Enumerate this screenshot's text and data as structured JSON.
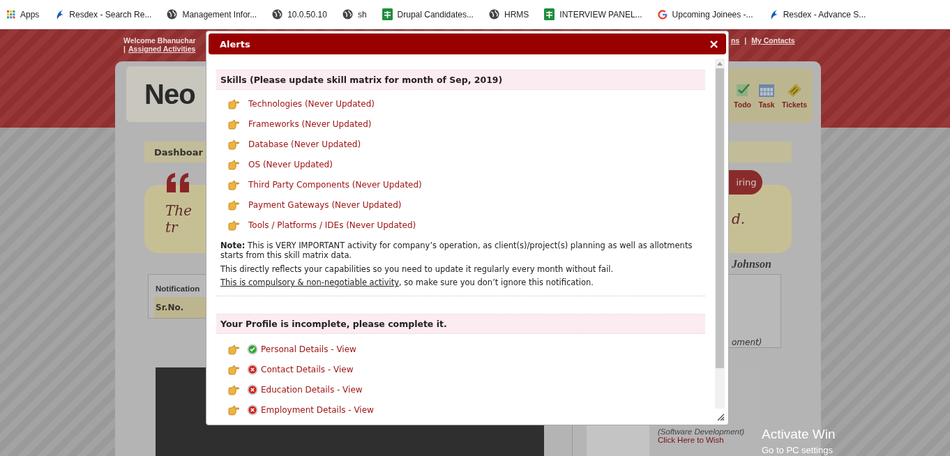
{
  "bookmarks": [
    {
      "kind": "apps",
      "label": "Apps"
    },
    {
      "kind": "resdex",
      "label": "Resdex - Search Re..."
    },
    {
      "kind": "globe",
      "label": "Management Infor..."
    },
    {
      "kind": "globe",
      "label": "10.0.50.10"
    },
    {
      "kind": "globe",
      "label": "sh"
    },
    {
      "kind": "sheets",
      "label": "Drupal Candidates..."
    },
    {
      "kind": "globe",
      "label": "HRMS"
    },
    {
      "kind": "sheets",
      "label": "INTERVIEW PANEL..."
    },
    {
      "kind": "google",
      "label": "Upcoming Joinees -..."
    },
    {
      "kind": "resdex",
      "label": "Resdex - Advance S..."
    }
  ],
  "header": {
    "welcome": "Welcome Bhanuchar",
    "assigned": "Assigned Activities",
    "assigned_separator": "|",
    "contacts_cut": "ns",
    "separator": "|",
    "contacts": "My Contacts"
  },
  "logo": {
    "text": "Neo"
  },
  "toolbar": [
    {
      "kind": "todo",
      "label": "Todo"
    },
    {
      "kind": "task",
      "label": "Task"
    },
    {
      "kind": "tickets",
      "label": "Tickets"
    }
  ],
  "dashboard_tab": "Dashboar",
  "quote": {
    "text": "The tr",
    "end": "d.",
    "author": "Johnson"
  },
  "pill_button": "iring",
  "notifications": {
    "title": "Notification",
    "column_1": "Sr.No."
  },
  "right_panel": {
    "text": "oment)"
  },
  "birthday": {
    "department": "(Software Development)",
    "link": "Click Here to Wish"
  },
  "os_notice": {
    "title": "Activate Win",
    "subtitle": "Go to PC settings"
  },
  "modal": {
    "title": "Alerts",
    "close": "×",
    "skills": {
      "heading": "Skills (Please update skill matrix for month of Sep, 2019)",
      "items": [
        "Technologies (Never Updated)",
        "Frameworks (Never Updated)",
        "Database (Never Updated)",
        "OS (Never Updated)",
        "Third Party Components (Never Updated)",
        "Payment Gateways (Never Updated)",
        "Tools / Platforms / IDEs (Never Updated)"
      ],
      "note": "**Note:** This is VERY IMPORTANT activity for company’s operation, as client(s)/project(s) planning as well as allotments starts from this skill matrix data.",
      "reminder": "This directly reflects your capabilities so you need to update it regularly every month without fail.",
      "warning": {
        "underlined": "This is compulsory & non-negotiable activity",
        "rest": ", so make sure you don’t ignore this notification."
      }
    },
    "profile": {
      "heading": "Your Profile is incomplete, please complete it.",
      "items": [
        {
          "label": "Personal Details - View",
          "complete": true
        },
        {
          "label": "Contact Details - View",
          "complete": false
        },
        {
          "label": "Education Details - View",
          "complete": false
        },
        {
          "label": "Employment Details - View",
          "complete": false
        }
      ]
    }
  }
}
